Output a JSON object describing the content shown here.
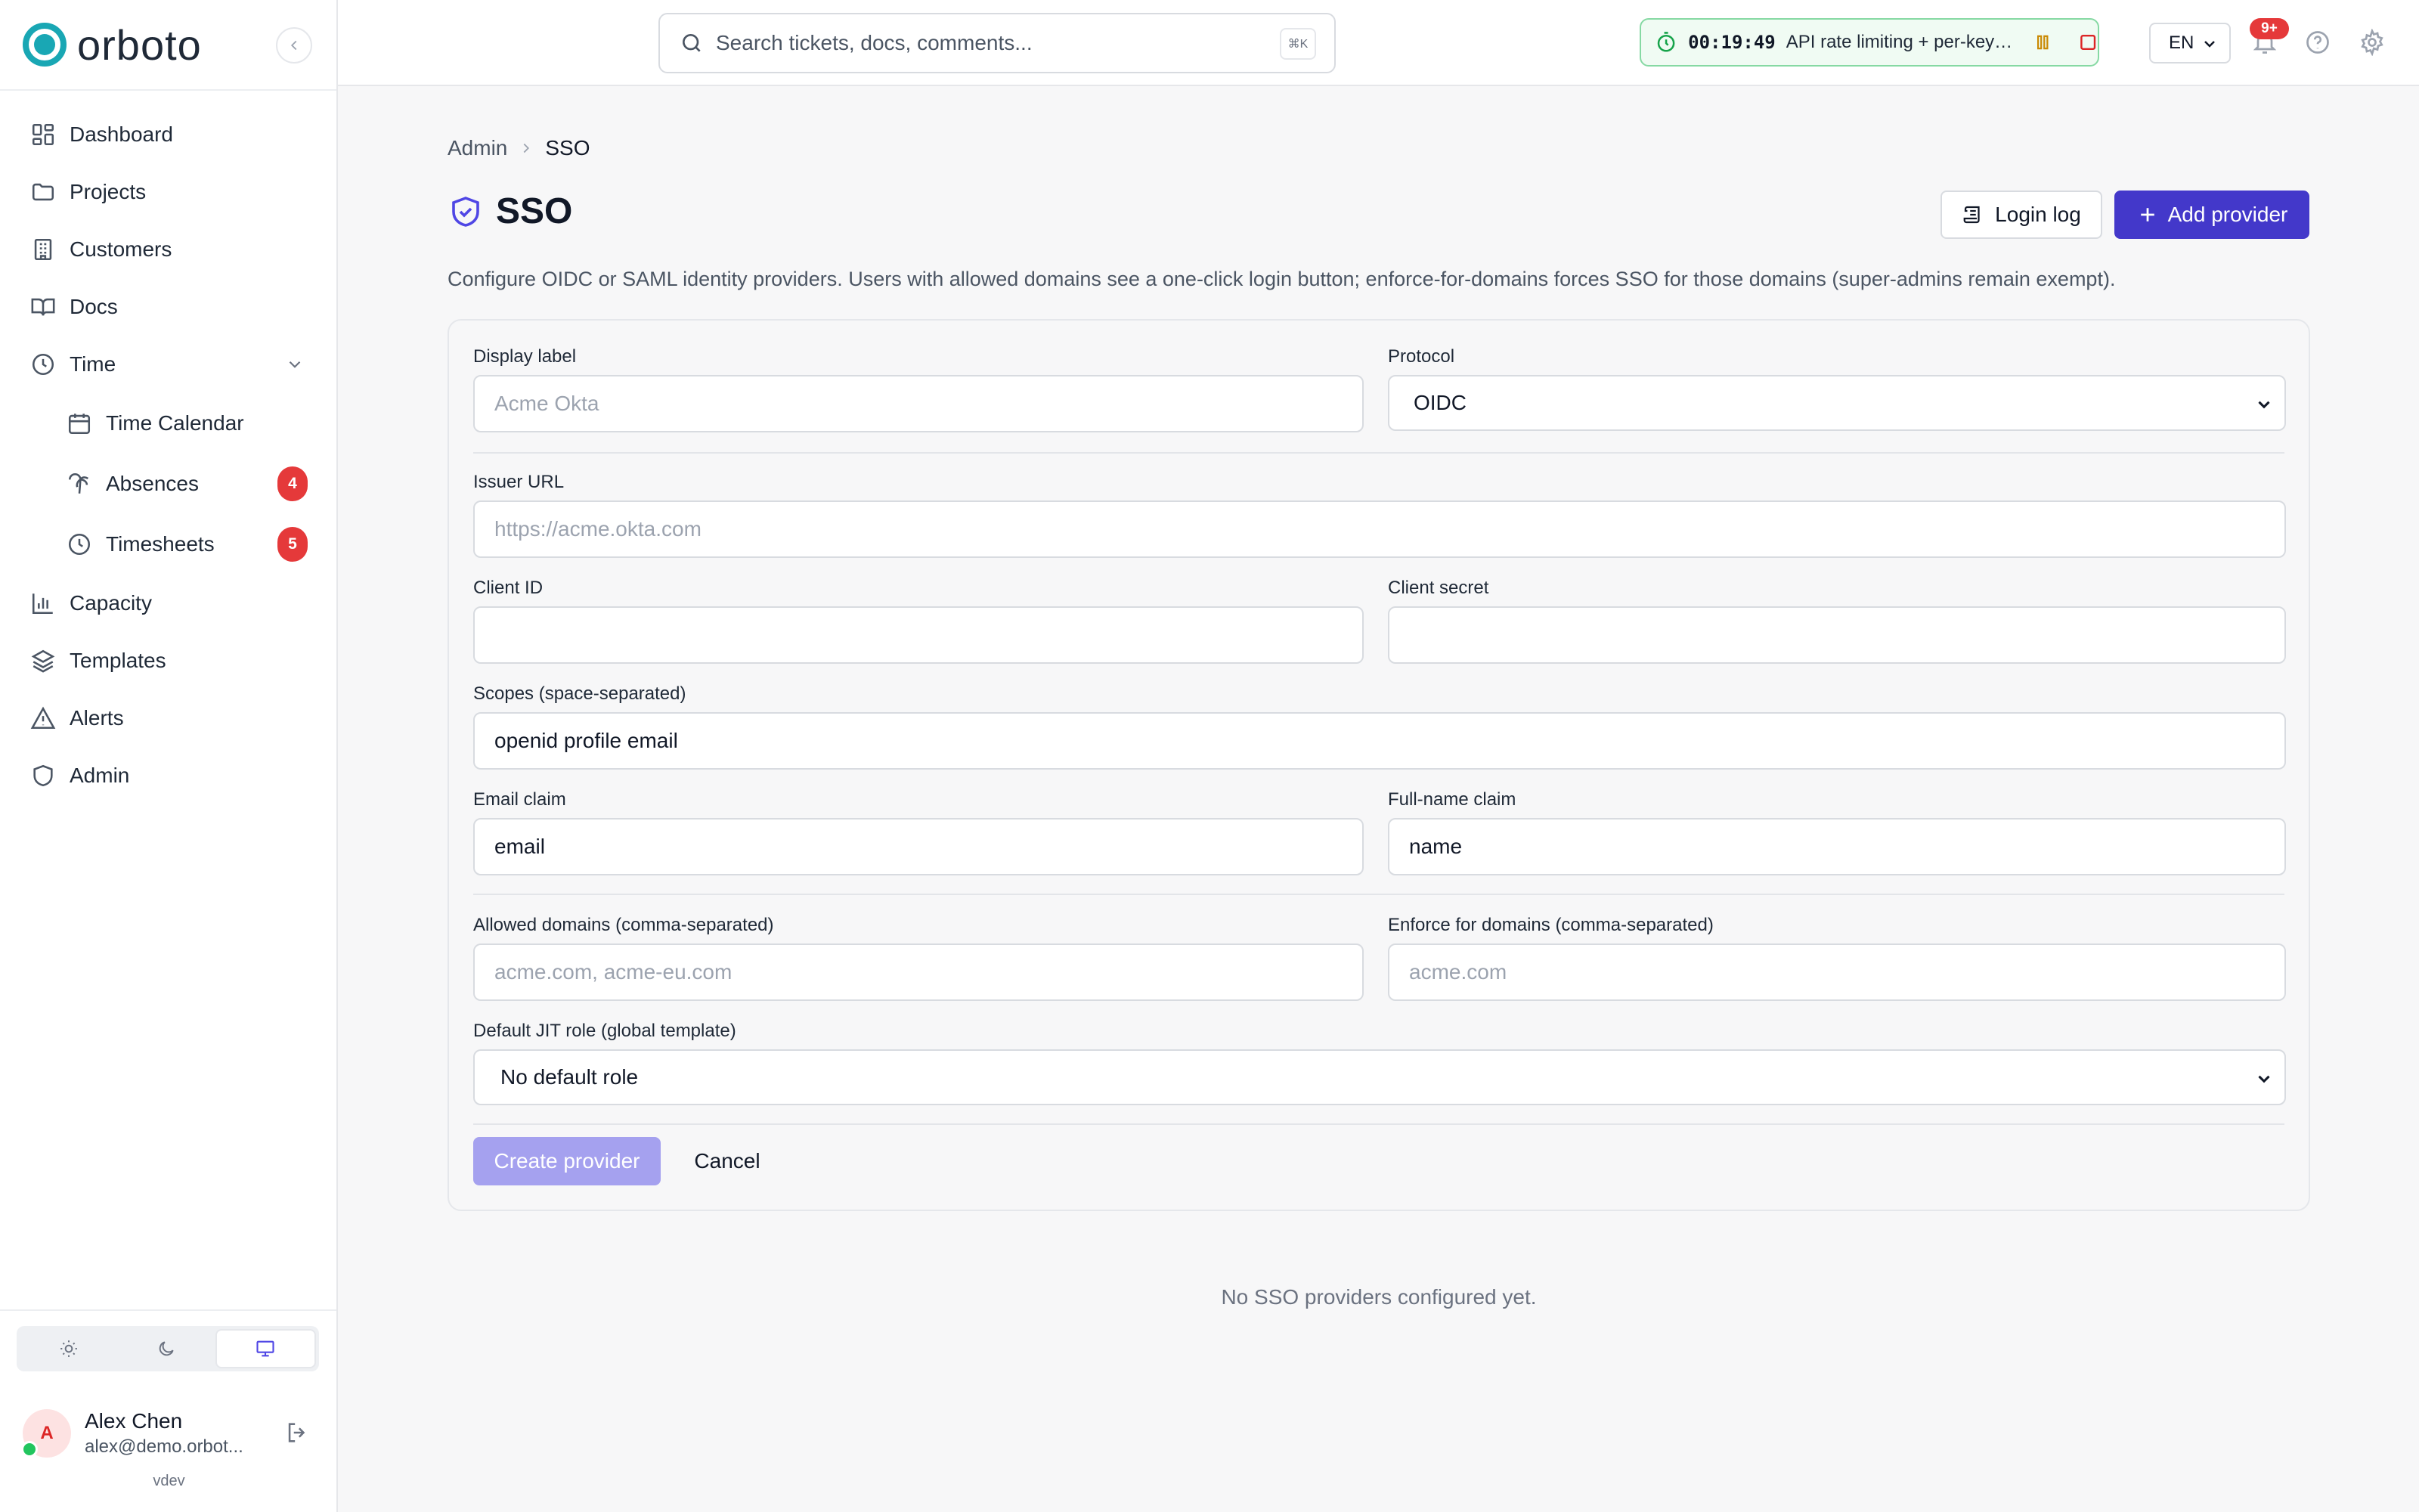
{
  "brand": {
    "name": "orboto",
    "color": "#19a7b4"
  },
  "sidebar": {
    "items": [
      {
        "label": "Dashboard",
        "icon": "dashboard-icon"
      },
      {
        "label": "Projects",
        "icon": "folder-icon"
      },
      {
        "label": "Customers",
        "icon": "building-icon"
      },
      {
        "label": "Docs",
        "icon": "book-icon"
      },
      {
        "label": "Time",
        "icon": "clock-icon"
      }
    ],
    "time_children": [
      {
        "label": "Time Calendar",
        "icon": "calendar-icon"
      },
      {
        "label": "Absences",
        "icon": "palm-tree-icon",
        "badge": "4"
      },
      {
        "label": "Timesheets",
        "icon": "clock-icon",
        "badge": "5"
      }
    ],
    "items_after": [
      {
        "label": "Capacity",
        "icon": "bar-chart-icon"
      },
      {
        "label": "Templates",
        "icon": "layers-icon"
      },
      {
        "label": "Alerts",
        "icon": "warning-icon"
      },
      {
        "label": "Admin",
        "icon": "shield-icon"
      }
    ],
    "theme_options": [
      "light",
      "dark",
      "system"
    ],
    "theme_selected": "system",
    "user": {
      "initial": "A",
      "name": "Alex Chen",
      "email": "alex@demo.orbot..."
    },
    "version": "vdev"
  },
  "topbar": {
    "search_placeholder": "Search tickets, docs, comments...",
    "search_shortcut": "⌘K",
    "timer": {
      "elapsed": "00:19:49",
      "task": "API rate limiting + per-key ..."
    },
    "language": "EN",
    "notifications_badge": "9+"
  },
  "main": {
    "breadcrumb": {
      "parent": "Admin",
      "current": "SSO"
    },
    "title": "SSO",
    "login_log_label": "Login log",
    "add_provider_label": "Add provider",
    "description": "Configure OIDC or SAML identity providers. Users with allowed domains see a one-click login button; enforce-for-domains forces SSO for those domains (super-admins remain exempt).",
    "accent_color": "#4338ca",
    "form": {
      "display_label": {
        "label": "Display label",
        "placeholder": "Acme Okta",
        "value": ""
      },
      "protocol": {
        "label": "Protocol",
        "value": "OIDC"
      },
      "issuer_url": {
        "label": "Issuer URL",
        "placeholder": "https://acme.okta.com",
        "value": ""
      },
      "client_id": {
        "label": "Client ID",
        "value": ""
      },
      "client_secret": {
        "label": "Client secret",
        "value": ""
      },
      "scopes": {
        "label": "Scopes (space-separated)",
        "value": "openid profile email"
      },
      "email_claim": {
        "label": "Email claim",
        "value": "email"
      },
      "full_name_claim": {
        "label": "Full-name claim",
        "value": "name"
      },
      "allowed_domains": {
        "label": "Allowed domains (comma-separated)",
        "placeholder": "acme.com, acme-eu.com",
        "value": ""
      },
      "enforce_domains": {
        "label": "Enforce for domains (comma-separated)",
        "placeholder": "acme.com",
        "value": ""
      },
      "default_role": {
        "label": "Default JIT role (global template)",
        "value": "No default role"
      },
      "create_label": "Create provider",
      "cancel_label": "Cancel"
    },
    "empty_state": "No SSO providers configured yet."
  }
}
